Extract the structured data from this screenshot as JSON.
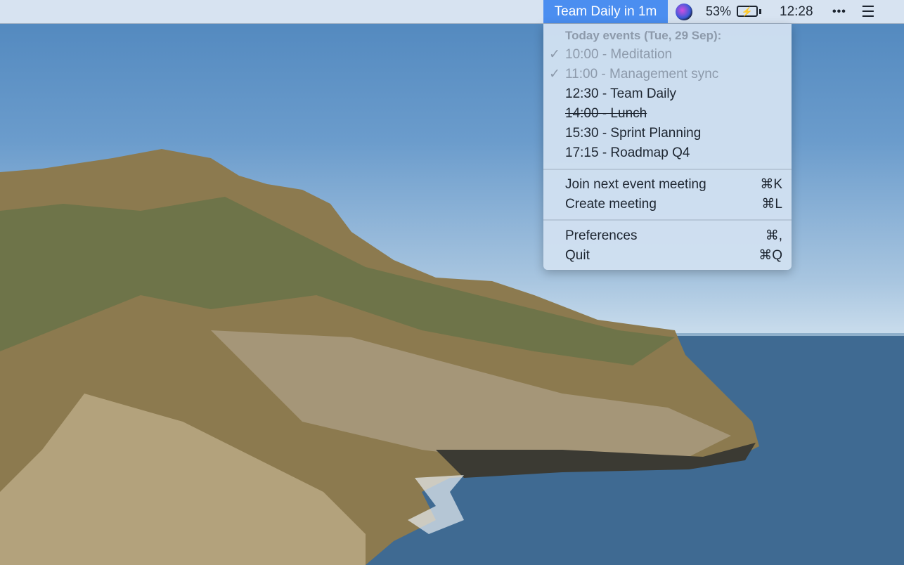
{
  "menubar": {
    "app_title": "Team Daily in 1m",
    "battery_percent": "53%",
    "clock": "12:28",
    "more_icon": "ellipsis-icon",
    "list_icon": "list-icon",
    "siri_icon": "siri-icon"
  },
  "menu": {
    "header": "Today events (Tue, 29 Sep):",
    "events": [
      {
        "label": "10:00 - Meditation",
        "state": "done"
      },
      {
        "label": "11:00 - Management sync",
        "state": "done"
      },
      {
        "label": "12:30 - Team Daily",
        "state": "upcoming"
      },
      {
        "label": "14:00 - Lunch",
        "state": "declined"
      },
      {
        "label": "15:30 - Sprint Planning",
        "state": "upcoming"
      },
      {
        "label": "17:15 - Roadmap Q4",
        "state": "upcoming"
      }
    ],
    "check": "✓",
    "actions": [
      {
        "label": "Join next event meeting",
        "shortcut": "⌘K"
      },
      {
        "label": "Create meeting",
        "shortcut": "⌘L"
      },
      {
        "label": "Preferences",
        "shortcut": "⌘,"
      },
      {
        "label": "Quit",
        "shortcut": "⌘Q"
      }
    ]
  }
}
